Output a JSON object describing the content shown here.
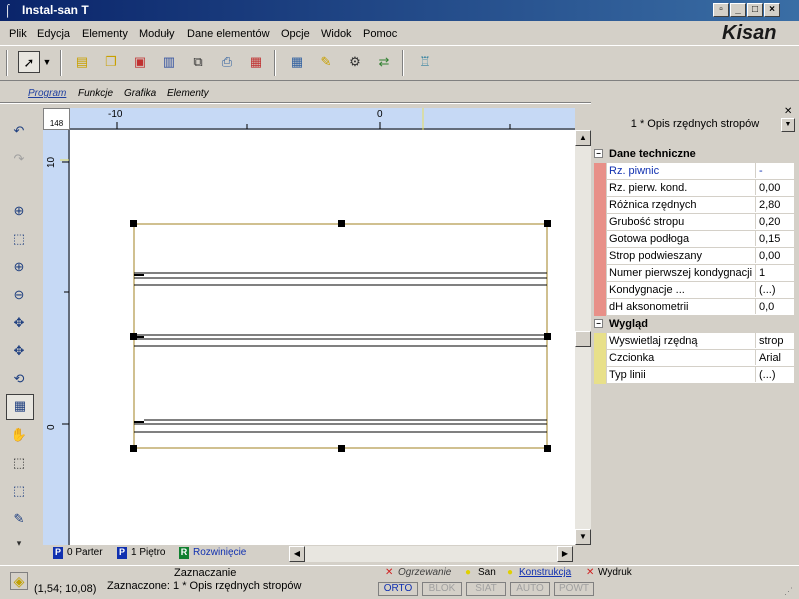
{
  "window": {
    "title": "Instal-san T",
    "controls": [
      "_",
      "□",
      "×"
    ]
  },
  "brand": {
    "logo": "Kisan"
  },
  "menu": [
    "Plik",
    "Edycja",
    "Elementy",
    "Moduły",
    "Dane elementów",
    "Opcje",
    "Widok",
    "Pomoc"
  ],
  "toolbar": {
    "icons": [
      "pointer-icon",
      "dropdown-arrow-icon",
      "new-icon",
      "open-icon",
      "export-icon",
      "save-icon",
      "copy-icon",
      "print-icon",
      "print-preview-icon",
      "calculator-icon",
      "edit-data-icon",
      "settings-icon",
      "transfer-icon",
      "pipe-icon"
    ]
  },
  "panel_tabs": [
    "Program",
    "Funkcje",
    "Grafika",
    "Elementy"
  ],
  "ruler": {
    "corner": "148",
    "top_labels": [
      "-10",
      "0"
    ],
    "left_labels": [
      "10",
      "0"
    ]
  },
  "sheet_tabs": [
    {
      "badge": "P",
      "label": "0 Parter"
    },
    {
      "badge": "P",
      "label": "1 Piętro"
    },
    {
      "badge": "R",
      "label": "Rozwinięcie"
    }
  ],
  "properties": {
    "title": "1 * Opis rzędnych stropów",
    "categories": [
      {
        "name": "Dane techniczne",
        "color": "#e89088",
        "rows": [
          {
            "name": "Rz. piwnic",
            "value": "-"
          },
          {
            "name": "Rz. pierw. kond.",
            "value": "0,00"
          },
          {
            "name": "Różnica rzędnych",
            "value": "2,80"
          },
          {
            "name": "Grubość stropu",
            "value": "0,20"
          },
          {
            "name": "Gotowa podłoga",
            "value": "0,15"
          },
          {
            "name": "Strop podwieszany",
            "value": "0,00"
          },
          {
            "name": "Numer pierwszej kondygnacji",
            "value": "1"
          },
          {
            "name": "Kondygnacje ...",
            "value": "(...)"
          },
          {
            "name": "dH aksonometrii",
            "value": "0,0"
          }
        ]
      },
      {
        "name": "Wygląd",
        "color": "#e8e08a",
        "rows": [
          {
            "name": "Wyswietlaj rzędną",
            "value": "strop"
          },
          {
            "name": "Czcionka",
            "value": "Arial"
          },
          {
            "name": "Typ linii",
            "value": "(...)"
          }
        ]
      }
    ]
  },
  "status": {
    "mode": "Zaznaczanie",
    "selection": "Zaznaczone: 1 * Opis rzędnych stropów",
    "coords": "(1,54; 10,08)"
  },
  "module_tabs": [
    "Ogrzewanie",
    "San",
    "Konstrukcja",
    "Wydruk"
  ],
  "modes": [
    "ORTO",
    "BLOK",
    "SIAT",
    "AUTO",
    "POWT"
  ]
}
